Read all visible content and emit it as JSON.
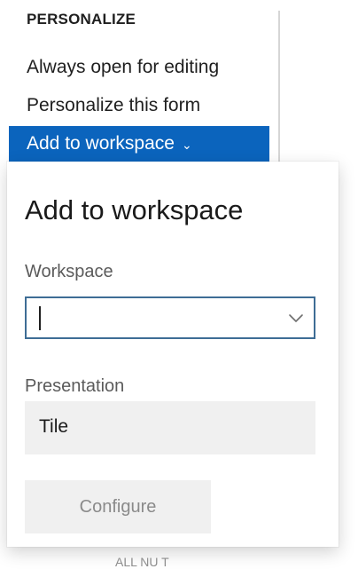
{
  "menu": {
    "heading": "PERSONALIZE",
    "items": [
      {
        "label": "Always open for editing"
      },
      {
        "label": "Personalize this form"
      },
      {
        "label": "Add to workspace",
        "selected": true
      }
    ],
    "selected_chevron": "⌄",
    "selected_bg": "#0b64bd"
  },
  "flyout": {
    "title": "Add to workspace",
    "workspace": {
      "label": "Workspace",
      "value": "",
      "icon": "chevron-down-icon"
    },
    "presentation": {
      "label": "Presentation",
      "value": "Tile"
    },
    "configure_label": "Configure"
  },
  "clipped": {
    "text": "ALL NU T"
  }
}
